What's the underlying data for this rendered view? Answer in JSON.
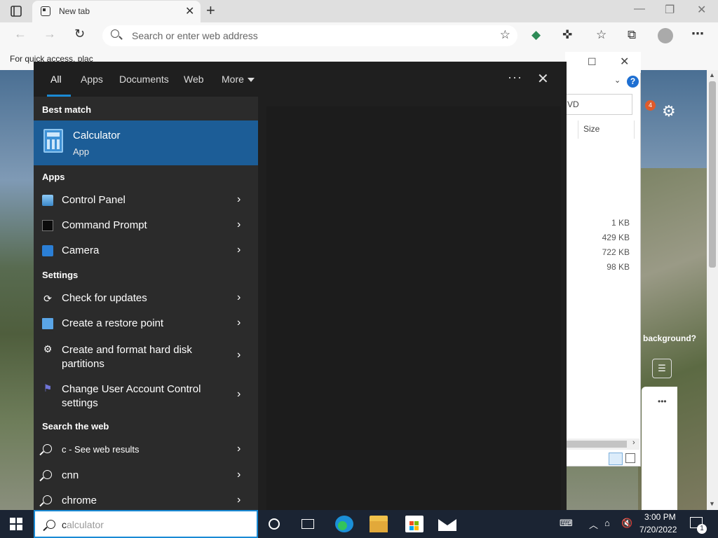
{
  "browser": {
    "tab_title": "New tab",
    "address_placeholder": "Search or enter web address",
    "favorites_bar_text": "For quick access, plac"
  },
  "background": {
    "notification_count": "4",
    "wallpaper_prompt": "background?",
    "explorer": {
      "address_fragment": "VD",
      "column_size": "Size",
      "file_sizes": [
        "1 KB",
        "429 KB",
        "722 KB",
        "98 KB"
      ]
    }
  },
  "search_panel": {
    "tabs": [
      {
        "label": "All",
        "active": true
      },
      {
        "label": "Apps"
      },
      {
        "label": "Documents"
      },
      {
        "label": "Web"
      },
      {
        "label": "More"
      }
    ],
    "best_match": {
      "heading": "Best match",
      "title": "Calculator",
      "subtitle": "App",
      "icon": "calculator-icon"
    },
    "apps": {
      "heading": "Apps",
      "items": [
        {
          "label": "Control Panel",
          "icon": "control-panel-icon"
        },
        {
          "label": "Command Prompt",
          "icon": "command-prompt-icon"
        },
        {
          "label": "Camera",
          "icon": "camera-icon"
        }
      ]
    },
    "settings": {
      "heading": "Settings",
      "items": [
        {
          "label": "Check for updates",
          "icon": "refresh-icon"
        },
        {
          "label": "Create a restore point",
          "icon": "monitor-icon"
        },
        {
          "label": "Create and format hard disk partitions",
          "icon": "gear-icon"
        },
        {
          "label": "Change User Account Control settings",
          "icon": "flag-icon"
        }
      ]
    },
    "web": {
      "heading": "Search the web",
      "items": [
        {
          "label": "c - See web results"
        },
        {
          "label": "cnn"
        },
        {
          "label": "chrome"
        }
      ]
    }
  },
  "taskbar": {
    "search_typed": "c",
    "search_suggestion": "alculator",
    "clock_time": "3:00 PM",
    "clock_date": "7/20/2022",
    "notification_count": "1"
  }
}
